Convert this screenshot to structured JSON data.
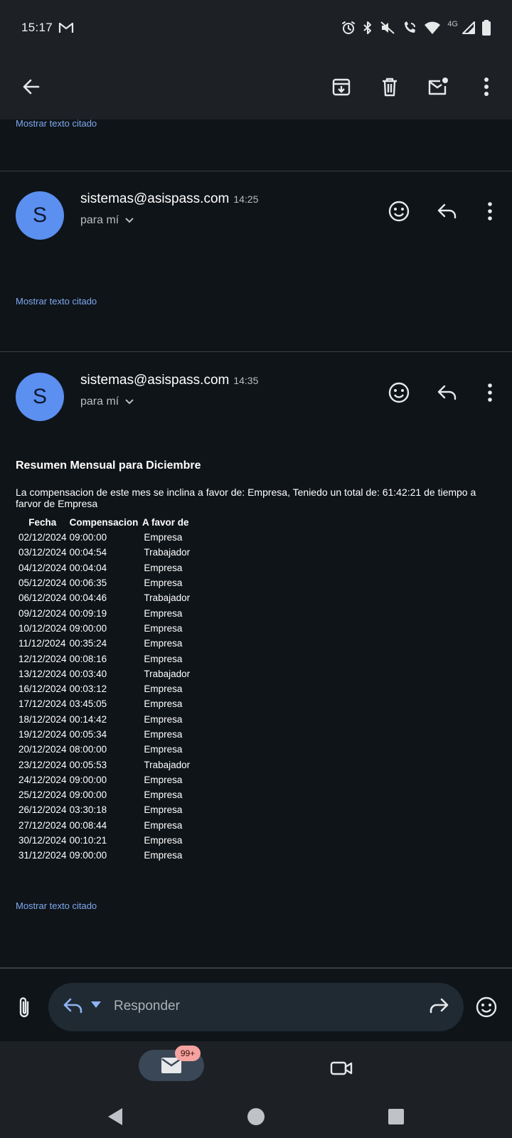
{
  "status": {
    "time": "15:17",
    "network": "4G"
  },
  "toolbar": {
    "back_icon": "arrow-back-icon",
    "archive_icon": "archive-icon",
    "delete_icon": "trash-icon",
    "unread_icon": "mark-unread-icon",
    "more_icon": "more-vert-icon"
  },
  "thread": {
    "quoted_label": "Mostrar texto citado",
    "messages": [
      {
        "avatar_letter": "S",
        "sender": "sistemas@asispass.com",
        "time": "14:25",
        "recipient": "para mí"
      },
      {
        "avatar_letter": "S",
        "sender": "sistemas@asispass.com",
        "time": "14:35",
        "recipient": "para mí"
      }
    ]
  },
  "report": {
    "title": "Resumen Mensual para Diciembre",
    "summary": "La compensacion de este mes se inclina a favor de: Empresa, Teniedo un total de: 61:42:21 de tiempo a farvor de Empresa",
    "headers": [
      "Fecha",
      "Compensacion",
      "A favor de"
    ],
    "rows": [
      [
        "02/12/2024",
        "09:00:00",
        "Empresa"
      ],
      [
        "03/12/2024",
        "00:04:54",
        "Trabajador"
      ],
      [
        "04/12/2024",
        "00:04:04",
        "Empresa"
      ],
      [
        "05/12/2024",
        "00:06:35",
        "Empresa"
      ],
      [
        "06/12/2024",
        "00:04:46",
        "Trabajador"
      ],
      [
        "09/12/2024",
        "00:09:19",
        "Empresa"
      ],
      [
        "10/12/2024",
        "09:00:00",
        "Empresa"
      ],
      [
        "11/12/2024",
        "00:35:24",
        "Empresa"
      ],
      [
        "12/12/2024",
        "00:08:16",
        "Empresa"
      ],
      [
        "13/12/2024",
        "00:03:40",
        "Trabajador"
      ],
      [
        "16/12/2024",
        "00:03:12",
        "Empresa"
      ],
      [
        "17/12/2024",
        "03:45:05",
        "Empresa"
      ],
      [
        "18/12/2024",
        "00:14:42",
        "Empresa"
      ],
      [
        "19/12/2024",
        "00:05:34",
        "Empresa"
      ],
      [
        "20/12/2024",
        "08:00:00",
        "Empresa"
      ],
      [
        "23/12/2024",
        "00:05:53",
        "Trabajador"
      ],
      [
        "24/12/2024",
        "09:00:00",
        "Empresa"
      ],
      [
        "25/12/2024",
        "09:00:00",
        "Empresa"
      ],
      [
        "26/12/2024",
        "03:30:18",
        "Empresa"
      ],
      [
        "27/12/2024",
        "00:08:44",
        "Empresa"
      ],
      [
        "30/12/2024",
        "00:10:21",
        "Empresa"
      ],
      [
        "31/12/2024",
        "09:00:00",
        "Empresa"
      ]
    ]
  },
  "reply": {
    "placeholder": "Responder"
  },
  "bottom_nav": {
    "mail_badge": "99+"
  },
  "colors": {
    "background": "#0f1418",
    "bar": "#1d2126",
    "link": "#7ea9f0",
    "avatar": "#5b8ff0",
    "badge": "#f5a3a0"
  }
}
